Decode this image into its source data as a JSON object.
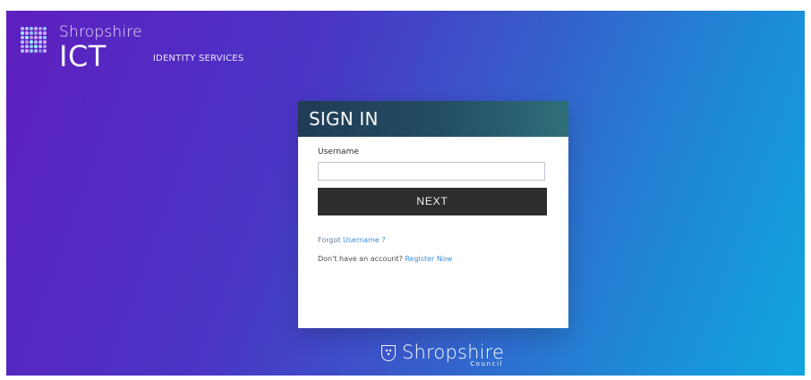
{
  "brand": {
    "top": "Shropshire",
    "main": "ICT",
    "sub": "IDENTITY SERVICES",
    "icon": "dot-grid-logo-icon"
  },
  "signin": {
    "title": "SIGN IN",
    "username_label": "Username",
    "username_value": "",
    "username_placeholder": "",
    "next_label": "NEXT",
    "forgot_prefix": "Forgot",
    "forgot_link": "Username ?",
    "register_prompt": "Don't have an account?",
    "register_link": "Register Now"
  },
  "footer": {
    "title": "Shropshire",
    "subtitle": "Council",
    "icon": "shropshire-crest-icon"
  },
  "colors": {
    "gradient_left": "#5e1fbf",
    "gradient_right": "#10a5e0",
    "header_dark": "#203b55",
    "header_teal": "#2f6f79",
    "button_bg": "#2d2d2d",
    "link": "#3b8fd9"
  }
}
